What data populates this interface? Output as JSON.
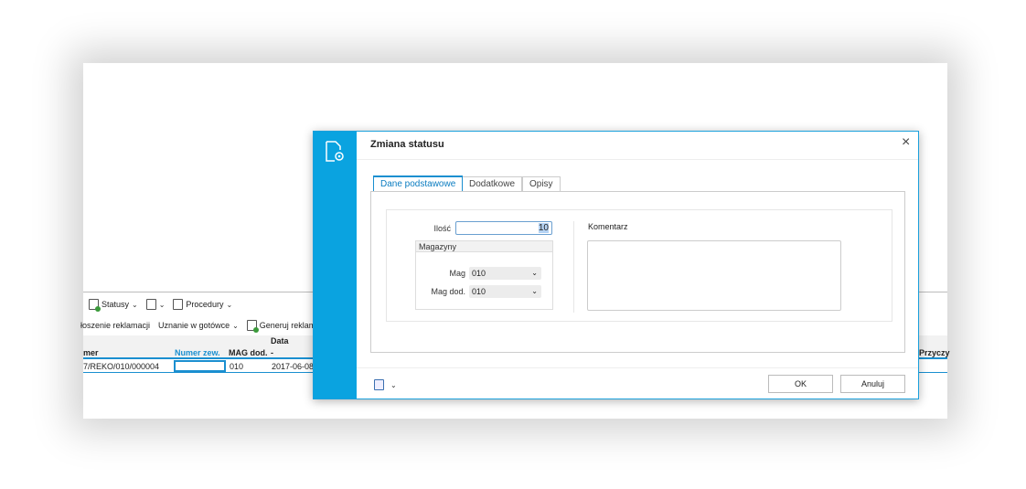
{
  "toolbar": {
    "statusy": "Statusy",
    "procedury": "Procedury"
  },
  "toolbar2": {
    "zgloszenie": "łoszenie reklamacji",
    "uznanie": "Uznanie w gotówce",
    "generuj": "Generuj reklam"
  },
  "grid": {
    "group_header": "Data",
    "columns": [
      "mer",
      "Numer zew.",
      "MAG dod.",
      "-"
    ],
    "row": [
      "7/REKO/010/000004",
      "",
      "010",
      "2017-06-08"
    ],
    "extra_header": "Przyczy"
  },
  "dialog": {
    "title": "Zmiana statusu",
    "tabs": [
      "Dane podstawowe",
      "Dodatkowe",
      "Opisy"
    ],
    "ilosc_label": "Ilość",
    "ilosc_value": "10",
    "magazyny_label": "Magazyny",
    "mag_label": "Mag",
    "mag_value": "010",
    "mag_dod_label": "Mag dod.",
    "mag_dod_value": "010",
    "komentarz_label": "Komentarz",
    "komentarz_value": "",
    "ok": "OK",
    "cancel": "Anuluj"
  },
  "colors": {
    "accent": "#0aa3e0"
  }
}
